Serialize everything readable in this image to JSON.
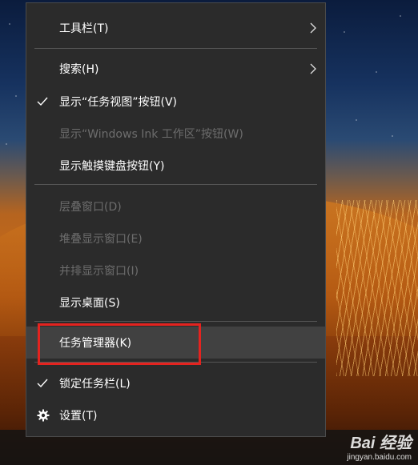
{
  "context_menu": {
    "items": [
      {
        "label": "工具栏(T)",
        "state": "normal",
        "submenu": true
      },
      {
        "label": "搜索(H)",
        "state": "normal",
        "submenu": true
      },
      {
        "label": "显示“任务视图”按钮(V)",
        "state": "normal",
        "checked": true
      },
      {
        "label": "显示“Windows Ink 工作区”按钮(W)",
        "state": "disabled"
      },
      {
        "label": "显示触摸键盘按钮(Y)",
        "state": "normal"
      },
      {
        "label": "层叠窗口(D)",
        "state": "disabled"
      },
      {
        "label": "堆叠显示窗口(E)",
        "state": "disabled"
      },
      {
        "label": "并排显示窗口(I)",
        "state": "disabled"
      },
      {
        "label": "显示桌面(S)",
        "state": "normal"
      },
      {
        "label": "任务管理器(K)",
        "state": "highlighted"
      },
      {
        "label": "锁定任务栏(L)",
        "state": "normal",
        "checked": true
      },
      {
        "label": "设置(T)",
        "state": "normal",
        "icon": "gear-icon"
      }
    ]
  },
  "colors": {
    "menu_bg": "#2b2b2b",
    "text": "#ffffff",
    "disabled_text": "#6d6d6d",
    "highlight": "#414141",
    "annotation_red": "#e4231f"
  },
  "watermark": {
    "logo": "Bai 经验",
    "url": "jingyan.baidu.com"
  }
}
